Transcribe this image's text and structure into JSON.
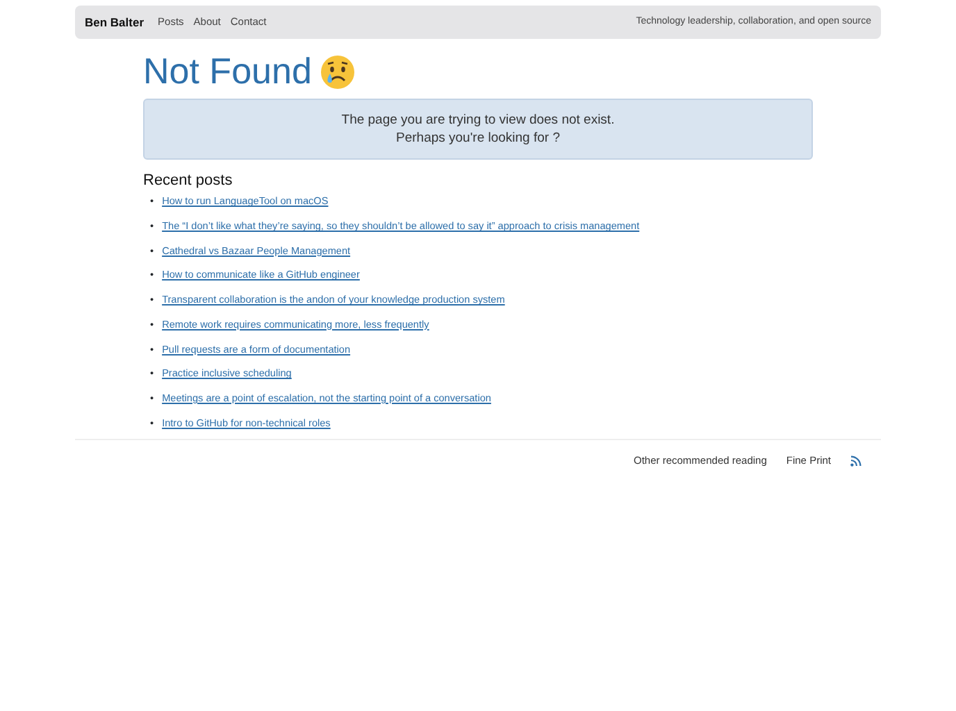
{
  "navbar": {
    "brand": "Ben Balter",
    "links": [
      "Posts",
      "About",
      "Contact"
    ],
    "tagline": "Technology leadership, collaboration, and open source"
  },
  "heading": "Not Found",
  "alert": {
    "lines": [
      "The page you are trying to view does not exist.",
      "Perhaps you're looking for ?"
    ]
  },
  "recent_posts": {
    "title": "Recent posts",
    "items": [
      {
        "marker": "•",
        "title": "How to run LanguageTool on macOS"
      },
      {
        "marker": "•",
        "title": "The “I don’t like what they’re saying, so they shouldn’t be allowed to say it” approach to crisis management"
      },
      {
        "marker": "•",
        "title": "Cathedral vs Bazaar People Management"
      },
      {
        "marker": "•",
        "title": "How to communicate like a GitHub engineer"
      },
      {
        "marker": "•",
        "title": "Transparent collaboration is the andon of your knowledge production system"
      },
      {
        "marker": "•",
        "title": "Remote work requires communicating more, less frequently"
      },
      {
        "marker": "•",
        "title": "Pull requests are a form of documentation"
      },
      {
        "marker": "•",
        "title": "Practice inclusive scheduling"
      },
      {
        "marker": "•",
        "title": "Meetings are a point of escalation, not the starting point of a conversation"
      },
      {
        "marker": "•",
        "title": "Intro to GitHub for non-technical roles"
      }
    ]
  },
  "footer": {
    "links": [
      "Other recommended reading",
      "Fine Print"
    ]
  }
}
